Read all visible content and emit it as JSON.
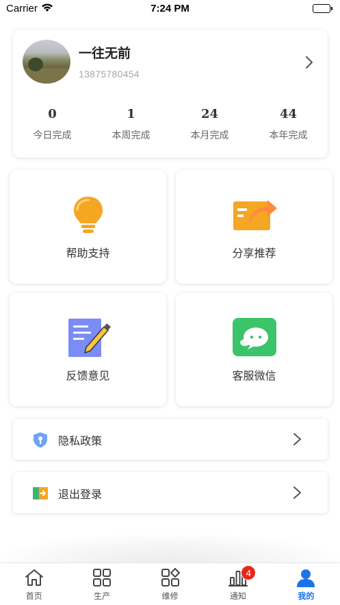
{
  "status_bar": {
    "carrier": "Carrier",
    "time": "7:24 PM"
  },
  "profile": {
    "name": "一往无前",
    "phone": "13875780454"
  },
  "stats": [
    {
      "value": "0",
      "label": "今日完成"
    },
    {
      "value": "1",
      "label": "本周完成"
    },
    {
      "value": "24",
      "label": "本月完成"
    },
    {
      "value": "44",
      "label": "本年完成"
    }
  ],
  "tiles": {
    "help": {
      "label": "帮助支持",
      "icon": "lightbulb-icon",
      "color": "#f5a623"
    },
    "share": {
      "label": "分享推荐",
      "icon": "share-arrow-icon",
      "color": "#f5a623"
    },
    "feedback": {
      "label": "反馈意见",
      "icon": "note-pencil-icon",
      "color": "#7b8cf5"
    },
    "wechat": {
      "label": "客服微信",
      "icon": "wechat-icon",
      "color": "#3cc46a"
    }
  },
  "rows": {
    "privacy": {
      "label": "隐私政策",
      "icon": "shield-lock-icon"
    },
    "logout": {
      "label": "退出登录",
      "icon": "exit-icon"
    }
  },
  "tabbar": {
    "items": [
      {
        "label": "首页",
        "icon": "home-icon"
      },
      {
        "label": "生产",
        "icon": "grid-icon"
      },
      {
        "label": "维修",
        "icon": "grid-diamond-icon"
      },
      {
        "label": "通知",
        "icon": "bar-chart-icon",
        "badge": "4"
      },
      {
        "label": "我的",
        "icon": "user-icon"
      }
    ],
    "active_color": "#1a73e8",
    "badge_color": "#e8261a"
  }
}
